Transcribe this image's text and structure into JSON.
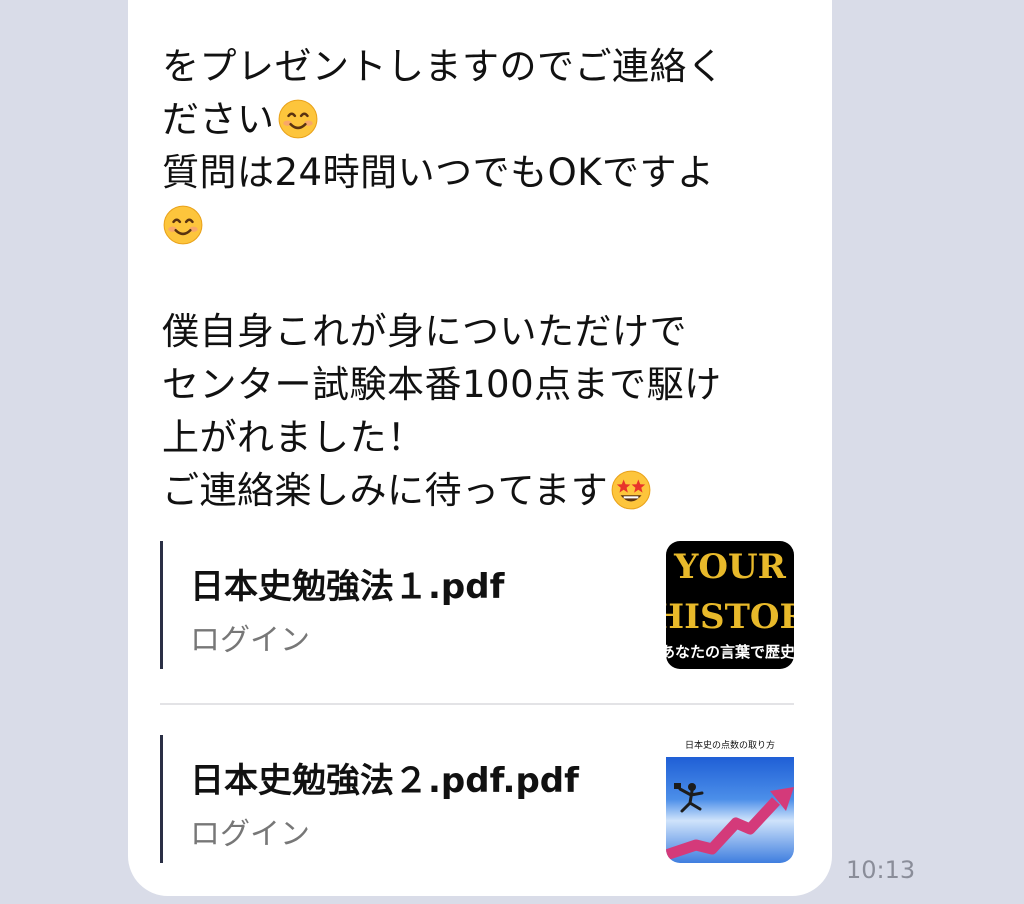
{
  "message": {
    "lines": [
      "をプレゼントしますのでご連絡く",
      "ださい",
      "質問は24時間いつでもOKですよ",
      "",
      "",
      "僕自身これが身についただけで",
      "センター試験本番100点まで駆け",
      "上がれました！",
      "ご連絡楽しみに待ってます"
    ],
    "emojis": [
      "smiling-face-emoji",
      "smiling-face-emoji",
      "star-struck-emoji"
    ]
  },
  "attachments": [
    {
      "title": "日本史勉強法１.pdf",
      "subtitle": "ログイン",
      "thumbnail": {
        "line1": "YOUR",
        "line2": "HISTORY",
        "line3": "あなたの言葉で歴史を語"
      }
    },
    {
      "title": "日本史勉強法２.pdf.pdf",
      "subtitle": "ログイン",
      "thumbnail": {
        "caption": "日本史の点数の取り方"
      }
    }
  ],
  "timestamp": "10:13",
  "colors": {
    "background": "#d9dce8",
    "bubble": "#ffffff",
    "accent_bar": "#2a2f45",
    "thumb_gold": "#e8b92a"
  }
}
